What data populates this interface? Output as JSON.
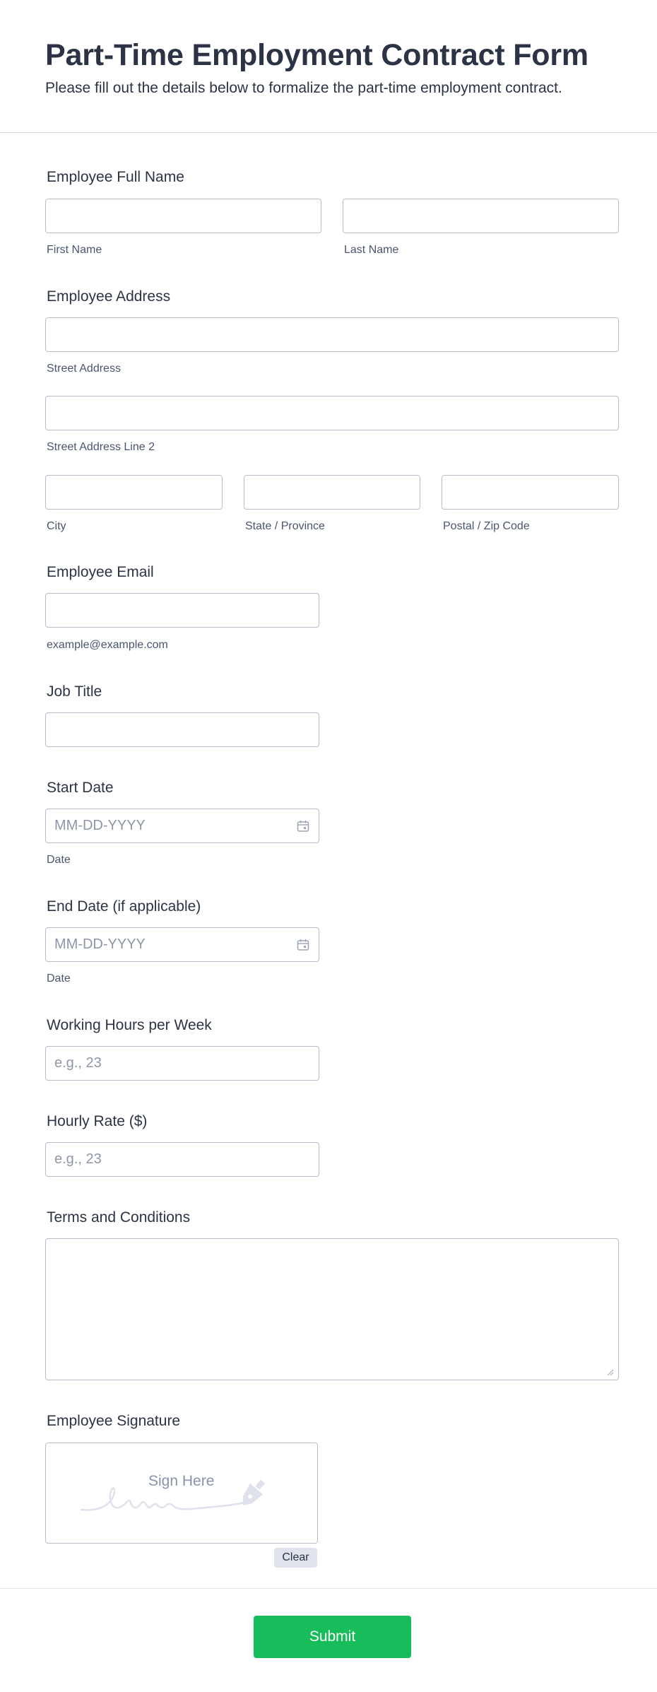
{
  "form": {
    "title": "Part-Time Employment Contract Form",
    "subtitle": "Please fill out the details below to formalize the part-time employment contract."
  },
  "fields": {
    "full_name": {
      "label": "Employee Full Name",
      "first_sub": "First Name",
      "last_sub": "Last Name"
    },
    "address": {
      "label": "Employee Address",
      "street_sub": "Street Address",
      "street2_sub": "Street Address Line 2",
      "city_sub": "City",
      "state_sub": "State / Province",
      "zip_sub": "Postal / Zip Code"
    },
    "email": {
      "label": "Employee Email",
      "sub": "example@example.com"
    },
    "job_title": {
      "label": "Job Title"
    },
    "start_date": {
      "label": "Start Date",
      "placeholder": "MM-DD-YYYY",
      "sub": "Date"
    },
    "end_date": {
      "label": "End Date (if applicable)",
      "placeholder": "MM-DD-YYYY",
      "sub": "Date"
    },
    "hours": {
      "label": "Working Hours per Week",
      "placeholder": "e.g., 23"
    },
    "rate": {
      "label": "Hourly Rate ($)",
      "placeholder": "e.g., 23"
    },
    "terms": {
      "label": "Terms and Conditions"
    },
    "signature": {
      "label": "Employee Signature",
      "placeholder": "Sign Here",
      "clear_label": "Clear"
    }
  },
  "submit_label": "Submit",
  "colors": {
    "text": "#2c3345",
    "submit": "#18bd5b",
    "border": "#b8bdc9"
  }
}
